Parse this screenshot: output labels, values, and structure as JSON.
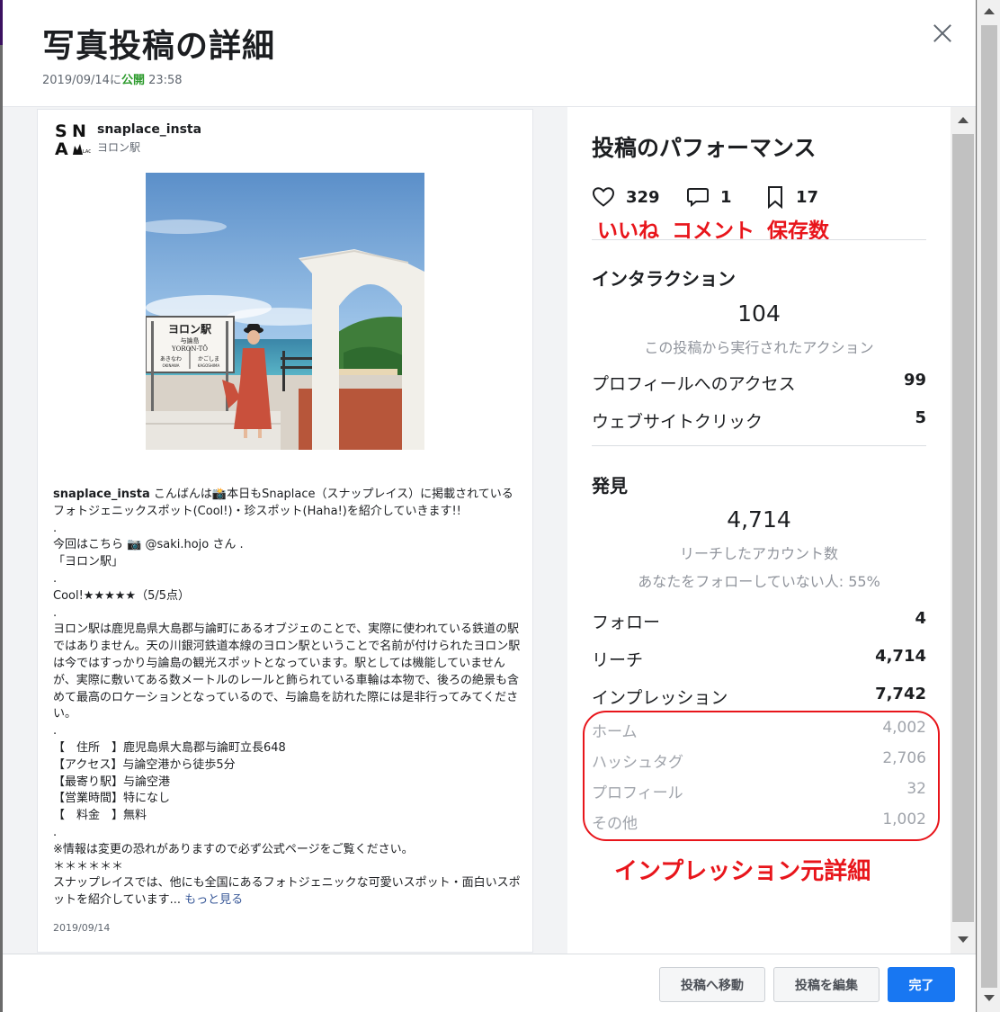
{
  "modal": {
    "title": "写真投稿の詳細",
    "published_date": "2019/09/14",
    "published_mid": "に",
    "published_status": "公開",
    "published_time": "23:58",
    "close_icon": "close-icon"
  },
  "post": {
    "avatar_letters": "SNAP",
    "username": "snaplace_insta",
    "location": "ヨロン駅",
    "photo_sign": {
      "title": "ヨロン駅",
      "sub": "与論島",
      "romaji": "YORON-TŌ",
      "left": "あきなわ",
      "right": "かごしま",
      "left_romaji": "OKINAWA",
      "right_romaji": "KAGOSHIMA"
    },
    "caption_username": "snaplace_insta",
    "caption_text": " こんばんは📸本日もSnaplace（スナップレイス）に掲載されているフォトジェニックスポット(Cool!)・珍スポット(Haha!)を紹介していきます!!\n.\n今回はこちら 📷 @saki.hojo さん .\n「ヨロン駅」\n.\nCool!★★★★★（5/5点）\n.\nヨロン駅は鹿児島県大島郡与論町にあるオブジェのことで、実際に使われている鉄道の駅ではありません。天の川銀河鉄道本線のヨロン駅ということで名前が付けられたヨロン駅は今ではすっかり与論島の観光スポットとなっています。駅としては機能していませんが、実際に敷いてある数メートルのレールと飾られている車輪は本物で、後ろの絶景も含めて最高のロケーションとなっているので、与論島を訪れた際には是非行ってみてください。\n.\n【　住所　】鹿児島県大島郡与論町立長648\n【アクセス】与論空港から徒歩5分\n【最寄り駅】与論空港\n【営業時間】特になし\n【　料金　】無料\n.\n※情報は変更の恐れがありますので必ず公式ページをご覧ください。\n＊＊＊＊＊＊\nスナップレイスでは、他にも全国にあるフォトジェニックな可愛いスポット・面白いスポットを紹介しています...",
    "more_label": "もっと見る",
    "date": "2019/09/14"
  },
  "performance": {
    "title": "投稿のパフォーマンス",
    "likes": "329",
    "comments": "1",
    "saves": "17",
    "annotation_likes": "いいね",
    "annotation_comments": "コメント",
    "annotation_saves": "保存数",
    "interaction": {
      "title": "インタラクション",
      "total": "104",
      "subtitle": "この投稿から実行されたアクション",
      "rows": [
        {
          "label": "プロフィールへのアクセス",
          "value": "99"
        },
        {
          "label": "ウェブサイトクリック",
          "value": "5"
        }
      ]
    },
    "discovery": {
      "title": "発見",
      "total": "4,714",
      "subtitle": "リーチしたアカウント数",
      "subtitle2": "あなたをフォローしていない人: 55%",
      "rows": [
        {
          "label": "フォロー",
          "value": "4"
        },
        {
          "label": "リーチ",
          "value": "4,714"
        },
        {
          "label": "インプレッション",
          "value": "7,742"
        }
      ],
      "impression_breakdown": [
        {
          "label": "ホーム",
          "value": "4,002"
        },
        {
          "label": "ハッシュタグ",
          "value": "2,706"
        },
        {
          "label": "プロフィール",
          "value": "32"
        },
        {
          "label": "その他",
          "value": "1,002"
        }
      ]
    },
    "impression_annotation": "インプレッション元詳細"
  },
  "footer": {
    "go_to_post": "投稿へ移動",
    "edit_post": "投稿を編集",
    "done": "完了"
  },
  "colors": {
    "accent_blue": "#1877f2",
    "annotation_red": "#e8151b",
    "published_green": "#2d9b2d"
  }
}
